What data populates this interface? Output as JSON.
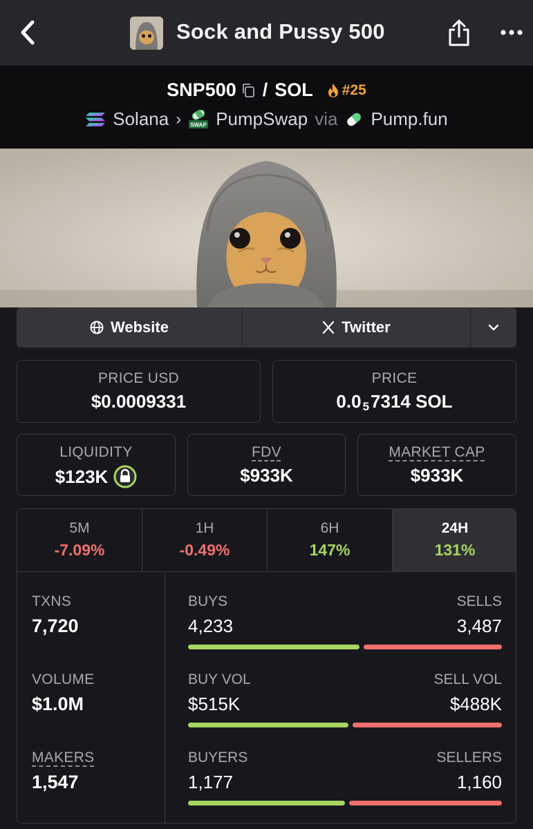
{
  "header": {
    "title": "Sock and Pussy 500",
    "back_icon": "chevron-left-icon",
    "share_icon": "share-icon",
    "more_icon": "more-dots-icon"
  },
  "pair": {
    "base": "SNP500",
    "separator": "/",
    "quote": "SOL",
    "rank": "#25",
    "chain": "Solana",
    "dex": "PumpSwap",
    "dex_badge": "SWAP",
    "via": "via",
    "launchpad": "Pump.fun"
  },
  "links": {
    "website": "Website",
    "twitter": "Twitter"
  },
  "stats": {
    "price_usd_label": "PRICE USD",
    "price_usd": "$0.0009331",
    "price_label": "PRICE",
    "price_prefix": "0.0",
    "price_sub": "5",
    "price_suffix": "7314 SOL",
    "liquidity_label": "LIQUIDITY",
    "liquidity": "$123K",
    "fdv_label": "FDV",
    "fdv": "$933K",
    "mcap_label": "MARKET CAP",
    "mcap": "$933K"
  },
  "timeframes": [
    {
      "label": "5M",
      "value": "-7.09%",
      "trend": "neg"
    },
    {
      "label": "1H",
      "value": "-0.49%",
      "trend": "neg"
    },
    {
      "label": "6H",
      "value": "147%",
      "trend": "pos"
    },
    {
      "label": "24H",
      "value": "131%",
      "trend": "pos",
      "active": true
    }
  ],
  "activity": {
    "txns_label": "TXNS",
    "txns": "7,720",
    "volume_label": "VOLUME",
    "volume": "$1.0M",
    "makers_label": "MAKERS",
    "makers": "1,547",
    "buys_label": "BUYS",
    "buys": "4,233",
    "sells_label": "SELLS",
    "sells": "3,487",
    "buy_vol_label": "BUY VOL",
    "buy_vol": "$515K",
    "sell_vol_label": "SELL VOL",
    "sell_vol": "$488K",
    "buyers_label": "BUYERS",
    "buyers": "1,177",
    "sellers_label": "SELLERS",
    "sellers": "1,160"
  },
  "colors": {
    "positive": "#a7d560",
    "negative": "#ef6f6f",
    "rank": "#f2a33a"
  }
}
